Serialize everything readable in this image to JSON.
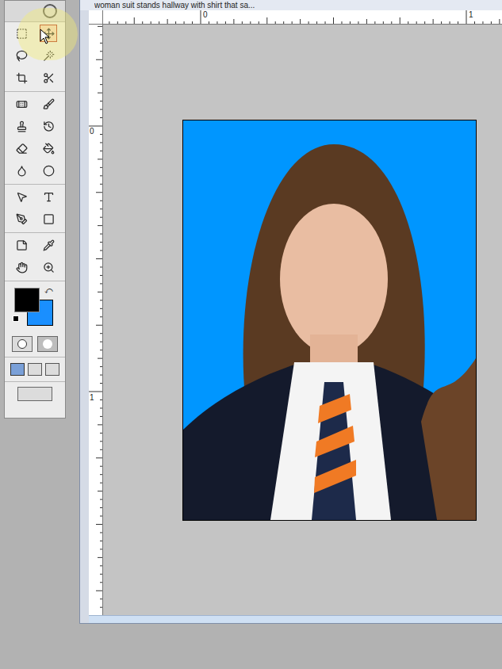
{
  "window": {
    "title": "woman suit stands hallway with shirt that sa..."
  },
  "toolbox": {
    "tools": [
      {
        "selected": false
      },
      {
        "selected": true
      },
      {
        "selected": false
      },
      {
        "selected": false
      },
      {
        "selected": false
      },
      {
        "selected": false
      },
      {
        "selected": false
      },
      {
        "selected": false
      },
      {
        "selected": false
      },
      {
        "selected": false
      },
      {
        "selected": false
      },
      {
        "selected": false
      },
      {
        "selected": false
      },
      {
        "selected": false
      },
      {
        "selected": false
      },
      {
        "selected": false
      },
      {
        "selected": false
      },
      {
        "selected": false
      },
      {
        "selected": false
      },
      {
        "selected": false
      },
      {
        "selected": false
      },
      {
        "selected": false
      }
    ],
    "swatches": {
      "foreground": "#000000",
      "background": "#1a8fff"
    }
  },
  "rulers": {
    "top": [
      "0",
      "1"
    ],
    "left": [
      "0",
      "1"
    ]
  }
}
